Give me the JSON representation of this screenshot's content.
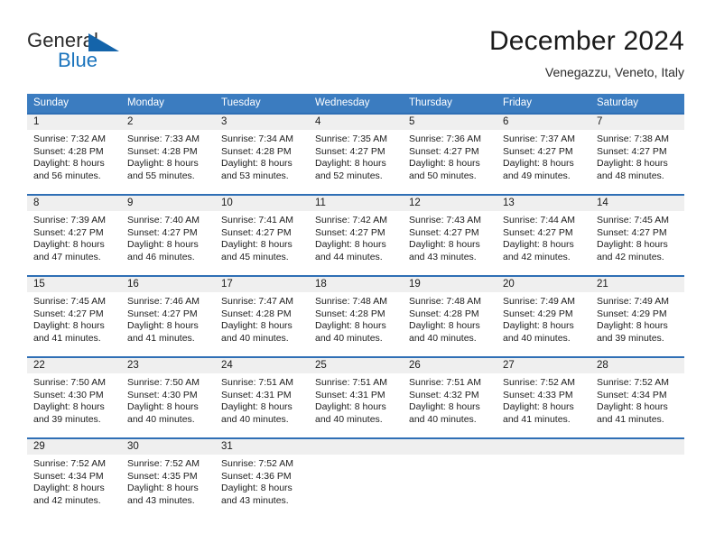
{
  "brand": {
    "line1": "General",
    "line2": "Blue",
    "triangle_color": "#1464aa",
    "blue_color": "#1b74bd"
  },
  "header": {
    "month_title": "December 2024",
    "location": "Venegazzu, Veneto, Italy"
  },
  "theme": {
    "header_row_bg": "#3b7cc0",
    "row_top_border": "#2f6fb5",
    "daynum_band_bg": "#efefef",
    "text_color": "#1c1c1c"
  },
  "weekday_headers": [
    "Sunday",
    "Monday",
    "Tuesday",
    "Wednesday",
    "Thursday",
    "Friday",
    "Saturday"
  ],
  "labels": {
    "sunrise_prefix": "Sunrise:",
    "sunset_prefix": "Sunset:",
    "daylight_prefix": "Daylight:"
  },
  "weeks": [
    [
      {
        "day": "1",
        "sunrise": "Sunrise: 7:32 AM",
        "sunset": "Sunset: 4:28 PM",
        "daylight_1": "Daylight: 8 hours",
        "daylight_2": "and 56 minutes."
      },
      {
        "day": "2",
        "sunrise": "Sunrise: 7:33 AM",
        "sunset": "Sunset: 4:28 PM",
        "daylight_1": "Daylight: 8 hours",
        "daylight_2": "and 55 minutes."
      },
      {
        "day": "3",
        "sunrise": "Sunrise: 7:34 AM",
        "sunset": "Sunset: 4:28 PM",
        "daylight_1": "Daylight: 8 hours",
        "daylight_2": "and 53 minutes."
      },
      {
        "day": "4",
        "sunrise": "Sunrise: 7:35 AM",
        "sunset": "Sunset: 4:27 PM",
        "daylight_1": "Daylight: 8 hours",
        "daylight_2": "and 52 minutes."
      },
      {
        "day": "5",
        "sunrise": "Sunrise: 7:36 AM",
        "sunset": "Sunset: 4:27 PM",
        "daylight_1": "Daylight: 8 hours",
        "daylight_2": "and 50 minutes."
      },
      {
        "day": "6",
        "sunrise": "Sunrise: 7:37 AM",
        "sunset": "Sunset: 4:27 PM",
        "daylight_1": "Daylight: 8 hours",
        "daylight_2": "and 49 minutes."
      },
      {
        "day": "7",
        "sunrise": "Sunrise: 7:38 AM",
        "sunset": "Sunset: 4:27 PM",
        "daylight_1": "Daylight: 8 hours",
        "daylight_2": "and 48 minutes."
      }
    ],
    [
      {
        "day": "8",
        "sunrise": "Sunrise: 7:39 AM",
        "sunset": "Sunset: 4:27 PM",
        "daylight_1": "Daylight: 8 hours",
        "daylight_2": "and 47 minutes."
      },
      {
        "day": "9",
        "sunrise": "Sunrise: 7:40 AM",
        "sunset": "Sunset: 4:27 PM",
        "daylight_1": "Daylight: 8 hours",
        "daylight_2": "and 46 minutes."
      },
      {
        "day": "10",
        "sunrise": "Sunrise: 7:41 AM",
        "sunset": "Sunset: 4:27 PM",
        "daylight_1": "Daylight: 8 hours",
        "daylight_2": "and 45 minutes."
      },
      {
        "day": "11",
        "sunrise": "Sunrise: 7:42 AM",
        "sunset": "Sunset: 4:27 PM",
        "daylight_1": "Daylight: 8 hours",
        "daylight_2": "and 44 minutes."
      },
      {
        "day": "12",
        "sunrise": "Sunrise: 7:43 AM",
        "sunset": "Sunset: 4:27 PM",
        "daylight_1": "Daylight: 8 hours",
        "daylight_2": "and 43 minutes."
      },
      {
        "day": "13",
        "sunrise": "Sunrise: 7:44 AM",
        "sunset": "Sunset: 4:27 PM",
        "daylight_1": "Daylight: 8 hours",
        "daylight_2": "and 42 minutes."
      },
      {
        "day": "14",
        "sunrise": "Sunrise: 7:45 AM",
        "sunset": "Sunset: 4:27 PM",
        "daylight_1": "Daylight: 8 hours",
        "daylight_2": "and 42 minutes."
      }
    ],
    [
      {
        "day": "15",
        "sunrise": "Sunrise: 7:45 AM",
        "sunset": "Sunset: 4:27 PM",
        "daylight_1": "Daylight: 8 hours",
        "daylight_2": "and 41 minutes."
      },
      {
        "day": "16",
        "sunrise": "Sunrise: 7:46 AM",
        "sunset": "Sunset: 4:27 PM",
        "daylight_1": "Daylight: 8 hours",
        "daylight_2": "and 41 minutes."
      },
      {
        "day": "17",
        "sunrise": "Sunrise: 7:47 AM",
        "sunset": "Sunset: 4:28 PM",
        "daylight_1": "Daylight: 8 hours",
        "daylight_2": "and 40 minutes."
      },
      {
        "day": "18",
        "sunrise": "Sunrise: 7:48 AM",
        "sunset": "Sunset: 4:28 PM",
        "daylight_1": "Daylight: 8 hours",
        "daylight_2": "and 40 minutes."
      },
      {
        "day": "19",
        "sunrise": "Sunrise: 7:48 AM",
        "sunset": "Sunset: 4:28 PM",
        "daylight_1": "Daylight: 8 hours",
        "daylight_2": "and 40 minutes."
      },
      {
        "day": "20",
        "sunrise": "Sunrise: 7:49 AM",
        "sunset": "Sunset: 4:29 PM",
        "daylight_1": "Daylight: 8 hours",
        "daylight_2": "and 40 minutes."
      },
      {
        "day": "21",
        "sunrise": "Sunrise: 7:49 AM",
        "sunset": "Sunset: 4:29 PM",
        "daylight_1": "Daylight: 8 hours",
        "daylight_2": "and 39 minutes."
      }
    ],
    [
      {
        "day": "22",
        "sunrise": "Sunrise: 7:50 AM",
        "sunset": "Sunset: 4:30 PM",
        "daylight_1": "Daylight: 8 hours",
        "daylight_2": "and 39 minutes."
      },
      {
        "day": "23",
        "sunrise": "Sunrise: 7:50 AM",
        "sunset": "Sunset: 4:30 PM",
        "daylight_1": "Daylight: 8 hours",
        "daylight_2": "and 40 minutes."
      },
      {
        "day": "24",
        "sunrise": "Sunrise: 7:51 AM",
        "sunset": "Sunset: 4:31 PM",
        "daylight_1": "Daylight: 8 hours",
        "daylight_2": "and 40 minutes."
      },
      {
        "day": "25",
        "sunrise": "Sunrise: 7:51 AM",
        "sunset": "Sunset: 4:31 PM",
        "daylight_1": "Daylight: 8 hours",
        "daylight_2": "and 40 minutes."
      },
      {
        "day": "26",
        "sunrise": "Sunrise: 7:51 AM",
        "sunset": "Sunset: 4:32 PM",
        "daylight_1": "Daylight: 8 hours",
        "daylight_2": "and 40 minutes."
      },
      {
        "day": "27",
        "sunrise": "Sunrise: 7:52 AM",
        "sunset": "Sunset: 4:33 PM",
        "daylight_1": "Daylight: 8 hours",
        "daylight_2": "and 41 minutes."
      },
      {
        "day": "28",
        "sunrise": "Sunrise: 7:52 AM",
        "sunset": "Sunset: 4:34 PM",
        "daylight_1": "Daylight: 8 hours",
        "daylight_2": "and 41 minutes."
      }
    ],
    [
      {
        "day": "29",
        "sunrise": "Sunrise: 7:52 AM",
        "sunset": "Sunset: 4:34 PM",
        "daylight_1": "Daylight: 8 hours",
        "daylight_2": "and 42 minutes."
      },
      {
        "day": "30",
        "sunrise": "Sunrise: 7:52 AM",
        "sunset": "Sunset: 4:35 PM",
        "daylight_1": "Daylight: 8 hours",
        "daylight_2": "and 43 minutes."
      },
      {
        "day": "31",
        "sunrise": "Sunrise: 7:52 AM",
        "sunset": "Sunset: 4:36 PM",
        "daylight_1": "Daylight: 8 hours",
        "daylight_2": "and 43 minutes."
      },
      {
        "day": "",
        "sunrise": "",
        "sunset": "",
        "daylight_1": "",
        "daylight_2": ""
      },
      {
        "day": "",
        "sunrise": "",
        "sunset": "",
        "daylight_1": "",
        "daylight_2": ""
      },
      {
        "day": "",
        "sunrise": "",
        "sunset": "",
        "daylight_1": "",
        "daylight_2": ""
      },
      {
        "day": "",
        "sunrise": "",
        "sunset": "",
        "daylight_1": "",
        "daylight_2": ""
      }
    ]
  ]
}
